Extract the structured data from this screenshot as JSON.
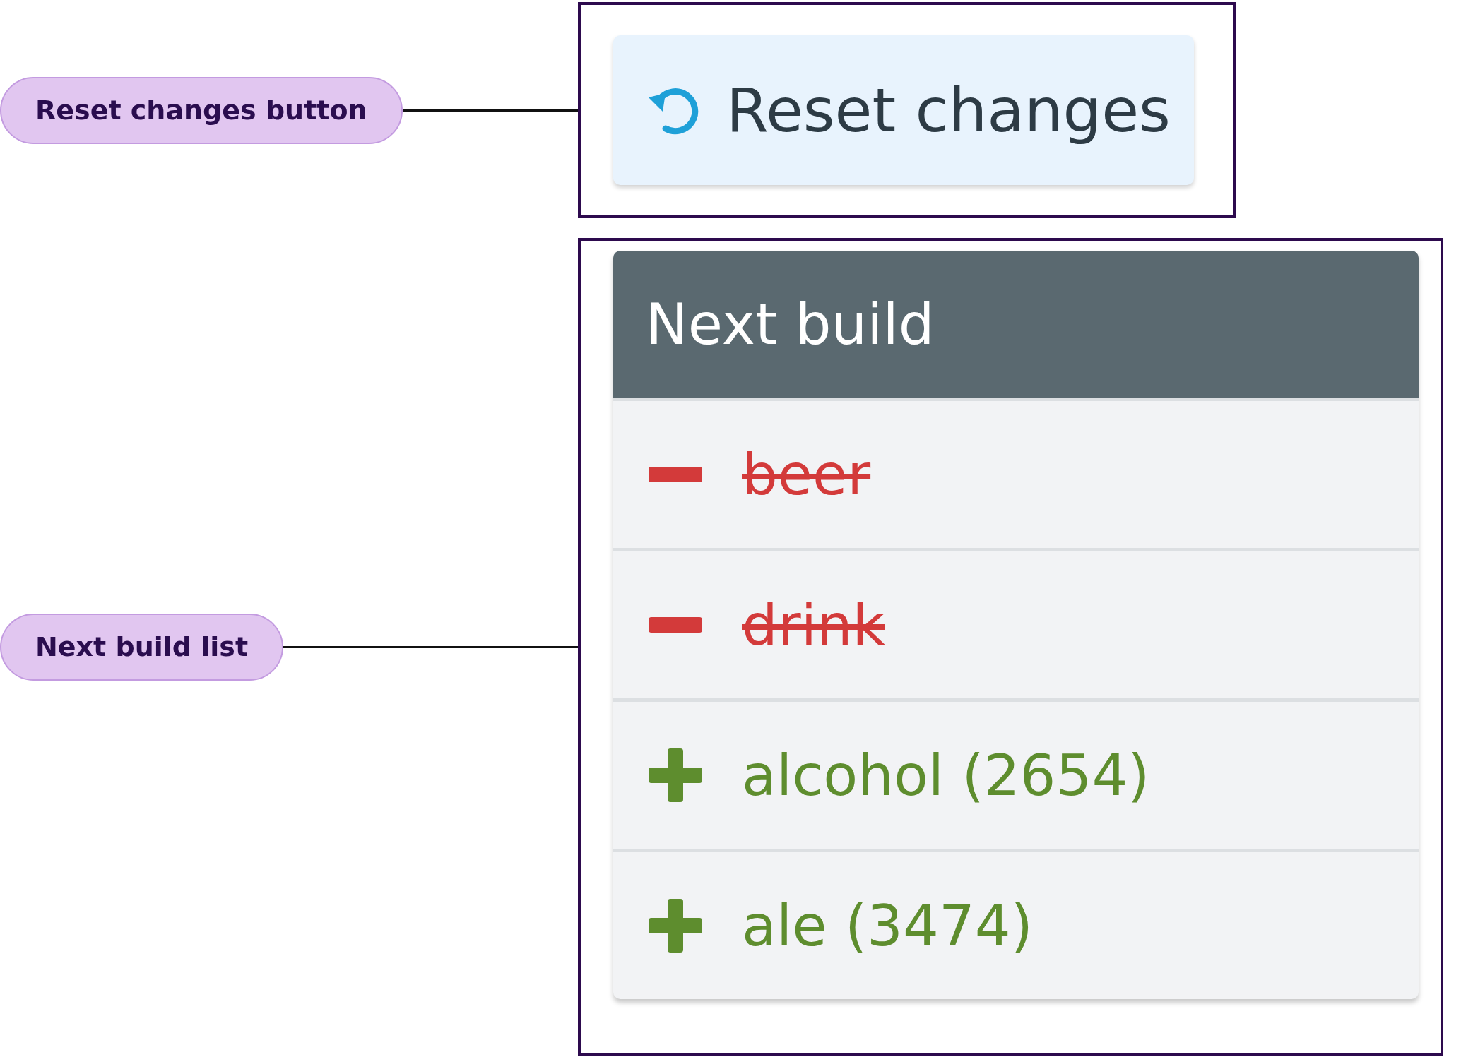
{
  "callouts": [
    {
      "label": "Reset changes button"
    },
    {
      "label": "Next build list"
    }
  ],
  "reset_button": {
    "label": "Reset changes"
  },
  "next_build": {
    "title": "Next build",
    "items": [
      {
        "kind": "removed",
        "label": "beer"
      },
      {
        "kind": "removed",
        "label": "drink"
      },
      {
        "kind": "added",
        "label": "alcohol (2654)"
      },
      {
        "kind": "added",
        "label": "ale (3474)"
      }
    ]
  }
}
